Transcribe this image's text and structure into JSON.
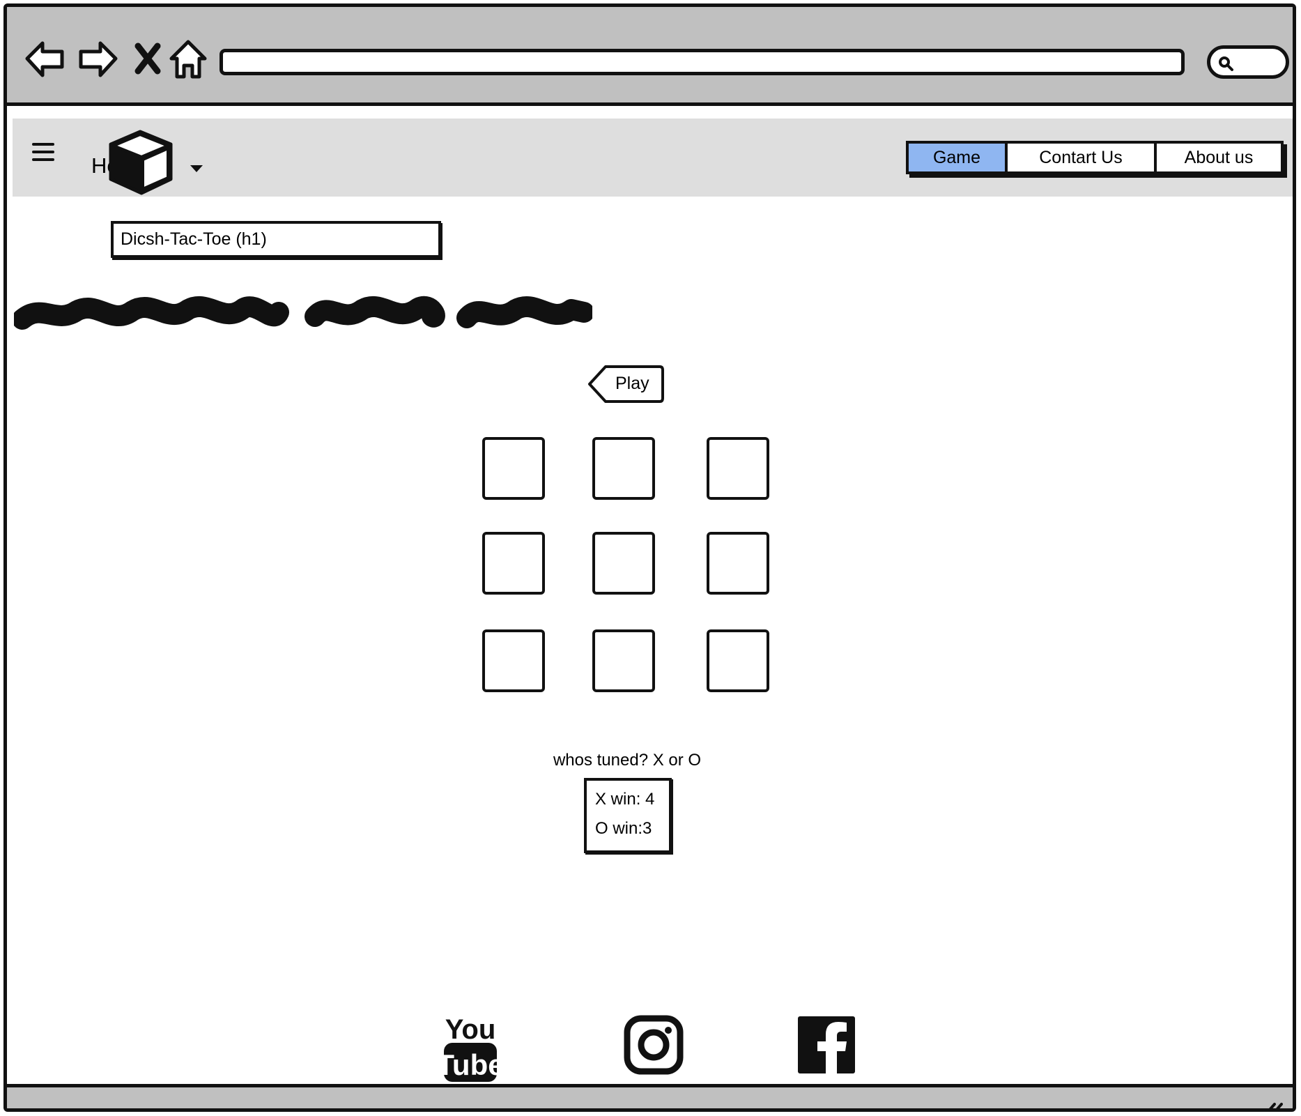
{
  "header": {
    "logo_text": "Heading",
    "tabs": [
      {
        "label": "Game",
        "active": true
      },
      {
        "label": "Contart Us",
        "active": false
      },
      {
        "label": "About us",
        "active": false
      }
    ]
  },
  "main": {
    "heading_box": "Dicsh-Tac-Toe (h1)",
    "play_button": "Play",
    "board": [
      [
        "",
        "",
        ""
      ],
      [
        "",
        "",
        ""
      ],
      [
        "",
        "",
        ""
      ]
    ],
    "turn_label": "whos tuned? X or O",
    "scores": {
      "x_win": "X win: 4",
      "o_win": "O win:3"
    }
  },
  "footer": {
    "social_icons": [
      "youtube-icon",
      "instagram-icon",
      "facebook-icon"
    ],
    "youtube_you": "You",
    "youtube_tube": "Tube"
  },
  "colors": {
    "chrome": "#c0c0c0",
    "header_bg": "#dedede",
    "active_tab": "#8fb6f1",
    "ink": "#111111"
  }
}
